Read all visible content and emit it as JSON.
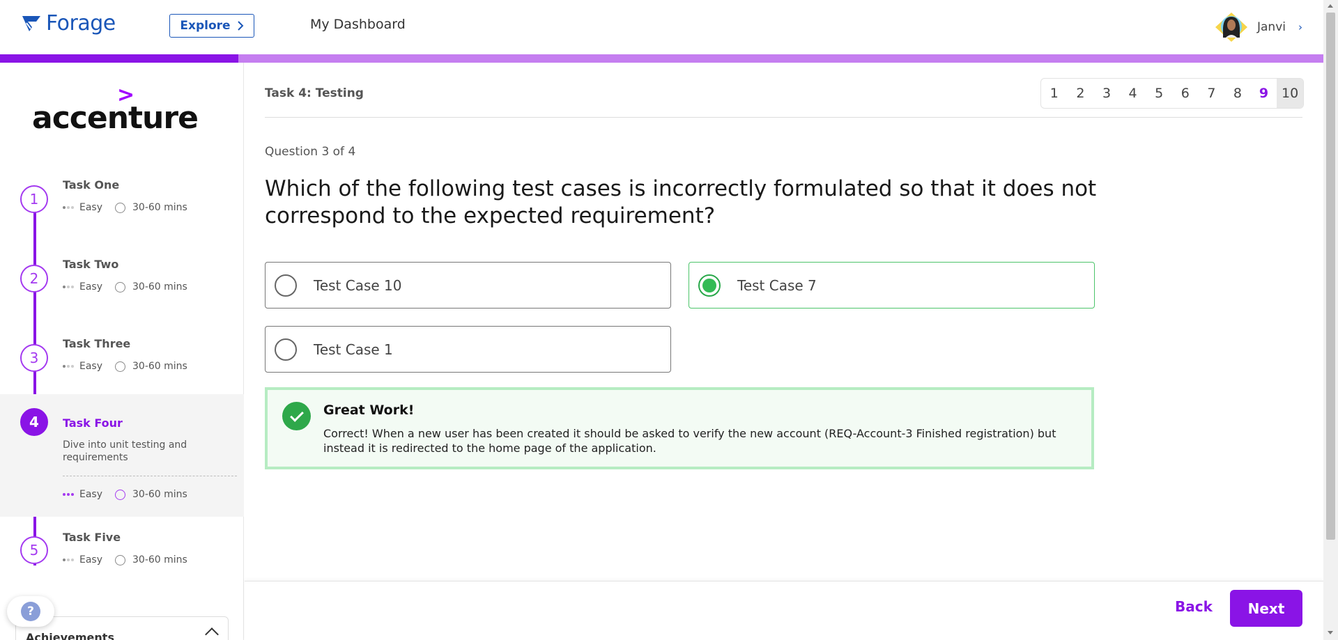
{
  "nav": {
    "logo_text": "Forage",
    "explore_label": "Explore",
    "dashboard_label": "My Dashboard",
    "user_name": "Janvi"
  },
  "progress_fraction": 0.18,
  "sidebar": {
    "brand": "accenture",
    "tasks": [
      {
        "number": "1",
        "title": "Task One",
        "difficulty": "Easy",
        "duration": "30-60 mins"
      },
      {
        "number": "2",
        "title": "Task Two",
        "difficulty": "Easy",
        "duration": "30-60 mins"
      },
      {
        "number": "3",
        "title": "Task Three",
        "difficulty": "Easy",
        "duration": "30-60 mins"
      },
      {
        "number": "4",
        "title": "Task Four",
        "description": "Dive into unit testing and requirements",
        "difficulty": "Easy",
        "duration": "30-60 mins",
        "active": true
      },
      {
        "number": "5",
        "title": "Task Five",
        "difficulty": "Easy",
        "duration": "30-60 mins"
      }
    ],
    "achievements_label": "Achievements"
  },
  "main": {
    "task_heading": "Task 4: Testing",
    "pages": [
      "1",
      "2",
      "3",
      "4",
      "5",
      "6",
      "7",
      "8",
      "9",
      "10"
    ],
    "current_page": "9",
    "question_count": "Question 3 of 4",
    "question": "Which of the following test cases is incorrectly formulated so that it does not correspond to the expected requirement?",
    "options": [
      {
        "label": "Test Case 10",
        "selected": false
      },
      {
        "label": "Test Case 7",
        "selected": true
      },
      {
        "label": "Test Case 1",
        "selected": false
      }
    ],
    "feedback": {
      "title": "Great Work!",
      "text": "Correct! When a new user has been created it should be asked to verify the new account (REQ-Account-3 Finished registration) but instead it is redirected to the home page of the application."
    },
    "back_label": "Back",
    "next_label": "Next"
  },
  "colors": {
    "brand_blue": "#1a56b8",
    "accent_purple": "#8a14e6",
    "progress_track": "#c57ef0",
    "success_green": "#2ea84a",
    "feedback_bg": "#f3fbf4"
  },
  "help_icon": "?"
}
